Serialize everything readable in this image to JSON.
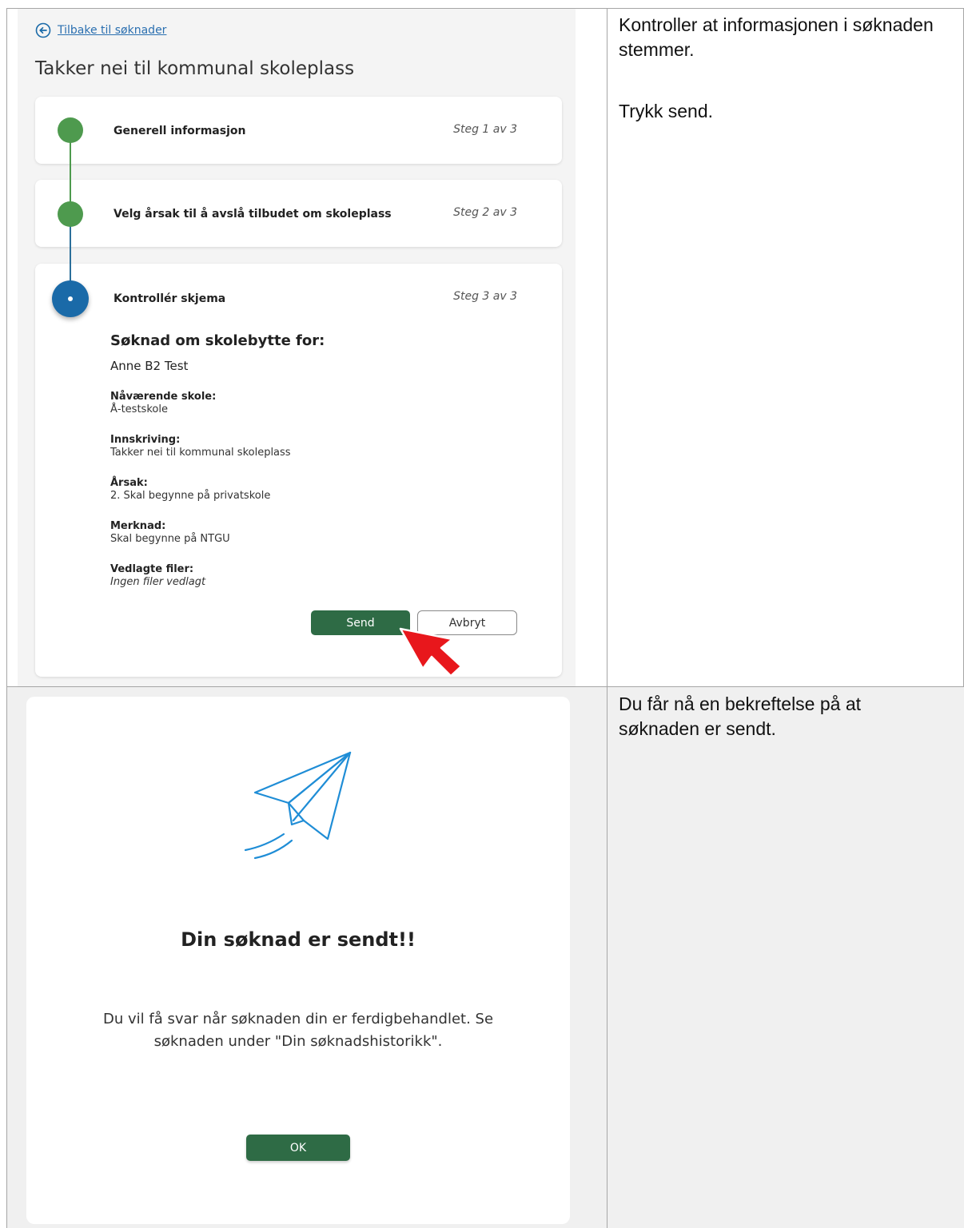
{
  "top_screen": {
    "back_link": "Tilbake til søknader",
    "page_title": "Takker nei til kommunal skoleplass",
    "steps": [
      {
        "title": "Generell informasjon",
        "count": "Steg 1 av 3"
      },
      {
        "title": "Velg årsak til å avslå tilbudet om skoleplass",
        "count": "Steg 2 av 3"
      },
      {
        "title": "Kontrollér skjema",
        "count": "Steg 3 av 3"
      }
    ],
    "summary": {
      "heading": "Søknad om skolebytte for:",
      "name": "Anne B2 Test",
      "fields": [
        {
          "label": "Nåværende skole:",
          "value": "Å-testskole"
        },
        {
          "label": "Innskriving:",
          "value": "Takker nei til kommunal skoleplass"
        },
        {
          "label": "Årsak:",
          "value": "2. Skal begynne på privatskole"
        },
        {
          "label": "Merknad:",
          "value": "Skal begynne på NTGU"
        },
        {
          "label": "Vedlagte filer:",
          "value": "Ingen filer vedlagt"
        }
      ]
    },
    "send_label": "Send",
    "cancel_label": "Avbryt"
  },
  "instructions": {
    "check": "Kontroller at informasjonen i søknaden stemmer.",
    "press": "Trykk send.",
    "confirm": "Du får nå en bekreftelse på at søknaden er sendt."
  },
  "bottom_screen": {
    "title": "Din søknad er sendt!!",
    "body": "Du vil få svar når søknaden din er ferdigbehandlet. Se søknaden under \"Din søknadshistorikk\".",
    "ok_label": "OK"
  },
  "colors": {
    "step_done": "#4e9a4e",
    "step_active": "#1a6aa8",
    "primary_button": "#2e6b45",
    "link": "#2a6fb0"
  }
}
